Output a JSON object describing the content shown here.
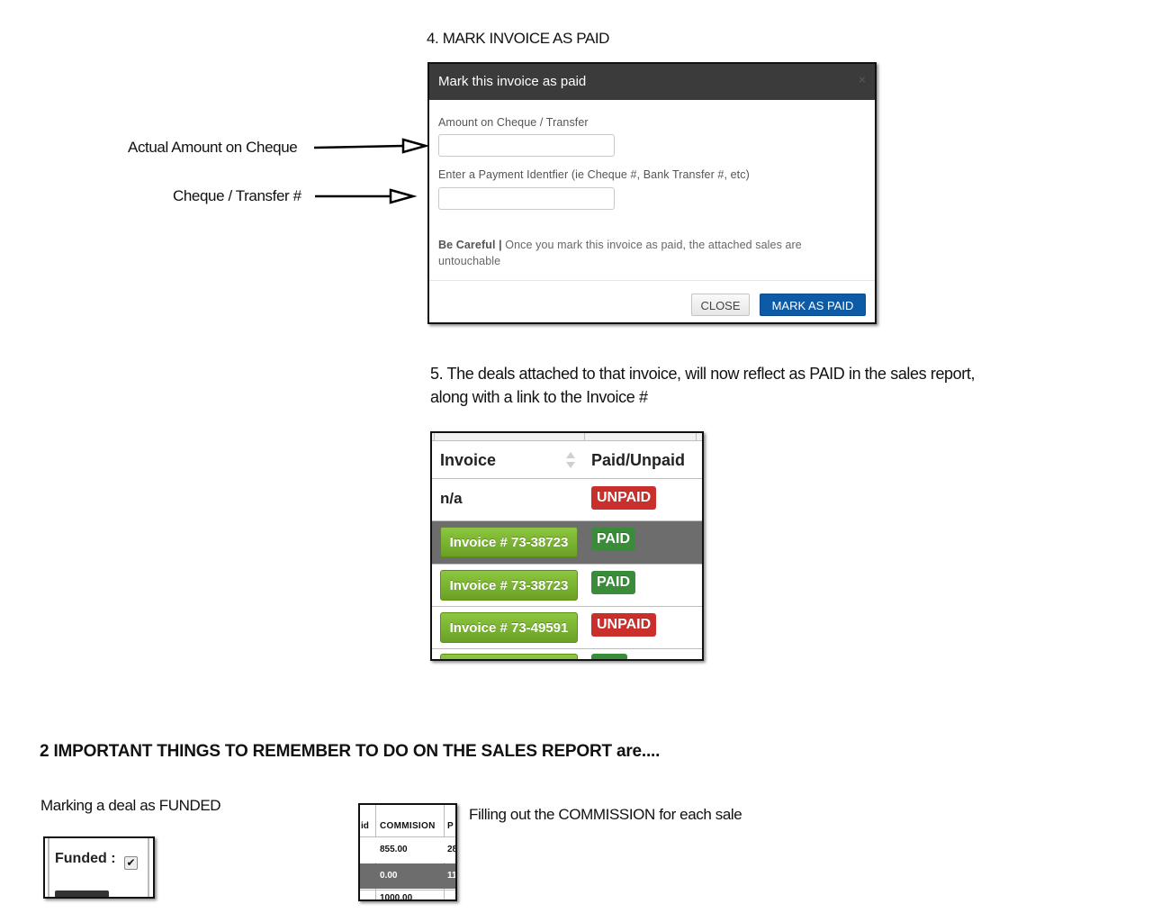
{
  "step4_title": "4. MARK INVOICE AS PAID",
  "annotations": {
    "amount": "Actual Amount on Cheque",
    "cheque": "Cheque / Transfer #"
  },
  "modal": {
    "title": "Mark this invoice as paid",
    "close_x": "×",
    "amount_label": "Amount on Cheque / Transfer",
    "amount_value": "",
    "payment_label": "Enter a Payment Identfier (ie Cheque #, Bank Transfer #, etc)",
    "payment_value": "",
    "warning_bold": "Be Careful |",
    "warning_text": " Once you mark this invoice as paid, the attached sales are",
    "warning_text2": "untouchable",
    "close_button": "CLOSE",
    "paid_button": "MARK AS PAID",
    "accent": "#0d5aa7",
    "header_bg": "#3b3b3b"
  },
  "step5_line1": "5. The deals attached to that invoice, will now reflect as PAID in the sales report,",
  "step5_line2": "along with a link to the Invoice #",
  "invoice_table": {
    "col_invoice": "Invoice",
    "col_paid": "Paid/Unpaid",
    "rows": [
      {
        "invoice": "n/a",
        "status": "UNPAID"
      },
      {
        "invoice": "Invoice # 73-38723",
        "status": "PAID"
      },
      {
        "invoice": "Invoice # 73-38723",
        "status": "PAID"
      },
      {
        "invoice": "Invoice # 73-49591",
        "status": "UNPAID"
      }
    ],
    "paid_color": "#3a8c3a",
    "unpaid_color": "#c9302c",
    "invoice_btn_color": "#7ab534"
  },
  "heading": "2 IMPORTANT THINGS TO REMEMBER TO DO ON THE SALES REPORT are....",
  "funded": {
    "caption": "Marking a deal as FUNDED",
    "label": "Funded :",
    "checked": true
  },
  "commission": {
    "caption": "Filling out the COMMISSION for each sale",
    "col_left": "id",
    "col_main": "COMMISION",
    "col_right": "P",
    "rows": [
      {
        "value": "855.00",
        "right": "28"
      },
      {
        "value": "0.00",
        "right": "11"
      },
      {
        "value": "1000.00",
        "right": ""
      }
    ]
  }
}
